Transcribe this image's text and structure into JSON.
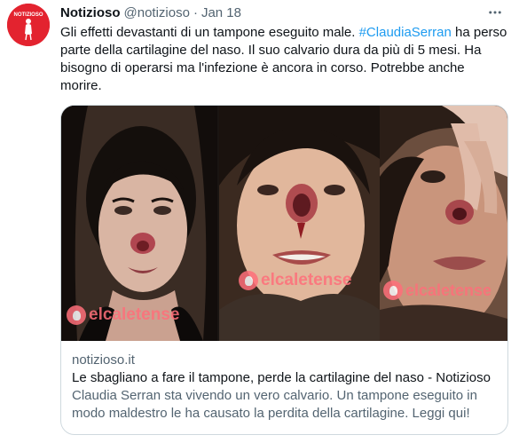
{
  "tweet": {
    "display_name": "Notizioso",
    "handle": "@notizioso",
    "separator": "·",
    "time": "Jan 18",
    "text_before_hashtag": "Gli effetti devastanti di un tampone eseguito male. ",
    "hashtag": "#ClaudiaSerran",
    "text_after_hashtag": " ha perso parte della cartilagine del naso. Il suo calvario dura da più di 5 mesi. Ha bisogno di operarsi ma l'infezione è ancora in corso. Potrebbe anche morire.",
    "avatar_label": "NOTIZIOSO"
  },
  "card": {
    "domain": "notizioso.it",
    "title": "Le sbagliano a fare il tampone, perde la cartilagine del naso - Notizioso",
    "description": "Claudia Serran sta vivendo un vero calvario. Un tampone eseguito in modo maldestro le ha causato la perdita della cartilagine. Leggi qui!",
    "watermark_1": "elcaletense",
    "watermark_2": "elcaletense",
    "watermark_3": "elcaletense"
  },
  "colors": {
    "accent": "#1d9bf0",
    "text_primary": "#0f1419",
    "text_secondary": "#536471",
    "border": "#cfd9de",
    "avatar_bg": "#e3232f",
    "watermark": "#ff6f7a"
  },
  "icons": {
    "more": "more-horizontal-icon"
  }
}
